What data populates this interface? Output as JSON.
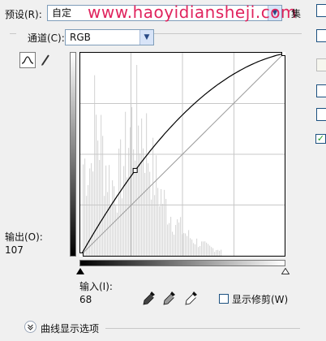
{
  "header": {
    "preset_label": "预设(R):",
    "preset_value": "自定",
    "watermark": "www.haoyidiansheji.com",
    "cut_label": "集"
  },
  "channel": {
    "label": "通道(C):",
    "value": "RGB"
  },
  "output": {
    "label": "输出(O):",
    "value": "107"
  },
  "input": {
    "label": "输入(I):",
    "value": "68"
  },
  "clipping": {
    "label": "显示修剪(W)",
    "checked": false
  },
  "curve_display": {
    "label": "曲线显示选项"
  },
  "right_panel": {
    "preview_checked": true
  },
  "curve": {
    "points": [
      {
        "input": 0,
        "output": 0
      },
      {
        "input": 68,
        "output": 107
      },
      {
        "input": 255,
        "output": 255
      }
    ]
  },
  "icons": [
    "curve-tool-icon",
    "pencil-icon",
    "black-eyedropper-icon",
    "gray-eyedropper-icon",
    "white-eyedropper-icon",
    "expand-icon",
    "dropdown-icon"
  ]
}
